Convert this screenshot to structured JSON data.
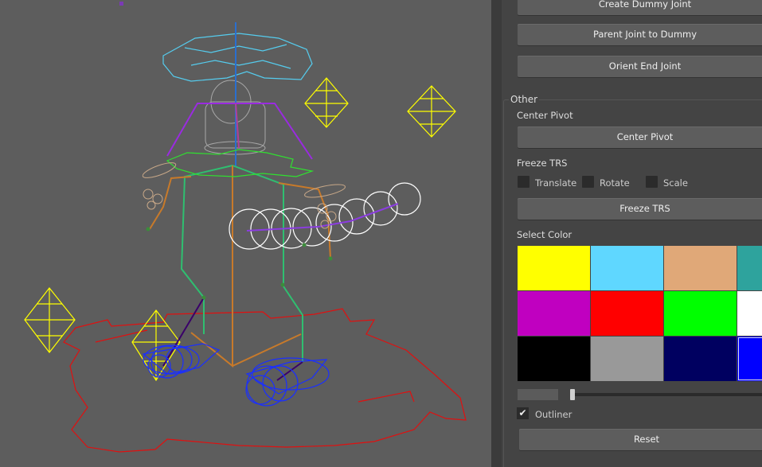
{
  "panel": {
    "buttons": {
      "create_dummy_joint": "Create Dummy Joint",
      "parent_joint_to_dummy": "Parent Joint to Dummy",
      "orient_end_joint": "Orient End Joint",
      "center_pivot": "Center Pivot",
      "freeze_trs": "Freeze TRS",
      "reset": "Reset"
    },
    "other_section": {
      "title": "Other",
      "center_pivot_label": "Center Pivot",
      "freeze_trs_label": "Freeze TRS",
      "select_color_label": "Select Color"
    },
    "freeze_options": [
      {
        "label": "Translate",
        "checked": false
      },
      {
        "label": "Rotate",
        "checked": false
      },
      {
        "label": "Scale",
        "checked": false
      }
    ],
    "color_swatches": [
      [
        "#ffff00",
        "#5fd7ff",
        "#e0a878",
        "#2ea39d"
      ],
      [
        "#c000c0",
        "#ff0000",
        "#00ff00",
        "#ffffff"
      ],
      [
        "#000000",
        "#999999",
        "#000060",
        "#0000ff"
      ]
    ],
    "selected_swatch": "#0000ff",
    "outliner": {
      "label": "Outliner",
      "checked": true,
      "check_glyph": "✔"
    }
  }
}
